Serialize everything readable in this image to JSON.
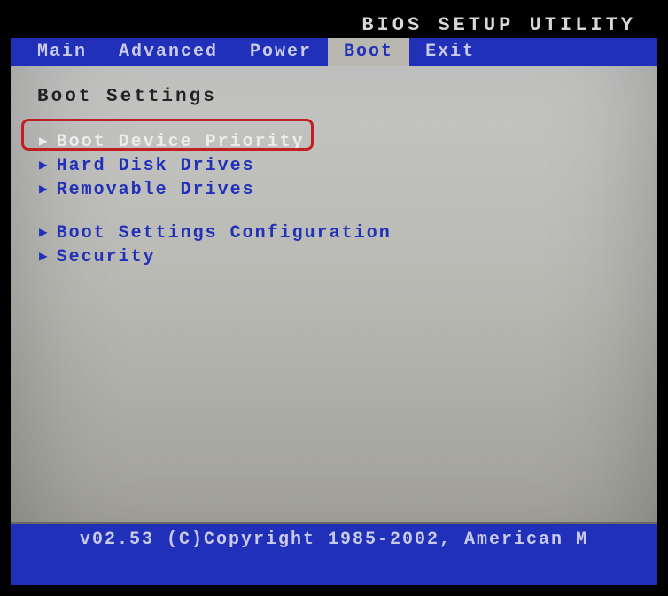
{
  "title": "BIOS SETUP UTILITY",
  "menu": {
    "items": [
      {
        "label": "Main",
        "active": false
      },
      {
        "label": "Advanced",
        "active": false
      },
      {
        "label": "Power",
        "active": false
      },
      {
        "label": "Boot",
        "active": true
      },
      {
        "label": "Exit",
        "active": false
      }
    ]
  },
  "section_title": "Boot Settings",
  "options": {
    "group1": [
      {
        "label": "Boot Device Priority",
        "selected": true
      },
      {
        "label": "Hard Disk Drives",
        "selected": false
      },
      {
        "label": "Removable Drives",
        "selected": false
      }
    ],
    "group2": [
      {
        "label": "Boot Settings Configuration",
        "selected": false
      },
      {
        "label": "Security",
        "selected": false
      }
    ]
  },
  "footer": "v02.53 (C)Copyright 1985-2002, American M"
}
